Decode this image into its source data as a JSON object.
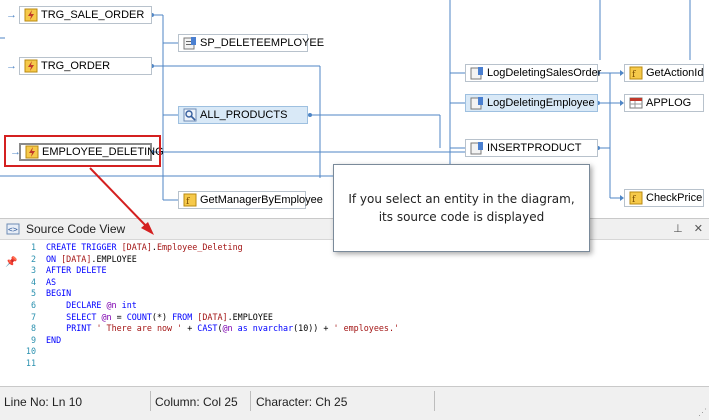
{
  "diagram": {
    "nodes": {
      "trg_sale_order": "TRG_SALE_ORDER",
      "trg_order": "TRG_ORDER",
      "employee_deleting": "EMPLOYEE_DELETING",
      "sp_deleteemployee": "SP_DELETEEMPLOYEE",
      "all_products": "ALL_PRODUCTS",
      "getmanagerbyemployee": "GetManagerByEmployee",
      "logdeletingsalesorder": "LogDeletingSalesOrder",
      "logdeletingemployee": "LogDeletingEmployee",
      "insertproduct": "INSERTPRODUCT",
      "getactionid": "GetActionId",
      "applog": "APPLOG",
      "checkprice": "CheckPrice"
    },
    "callout": "If you select an entity in the diagram, its source code is displayed",
    "colors": {
      "selection_box": "#d42020",
      "wire": "#4f86c6",
      "selected_node": "#d9e9f7"
    }
  },
  "source_panel": {
    "title": "Source Code View",
    "pin_icon": "pin-icon",
    "close_icon": "close-icon",
    "code_lines": [
      {
        "n": "1",
        "parts": [
          [
            "kw",
            "CREATE TRIGGER "
          ],
          [
            "br",
            "[DATA]"
          ],
          [
            "",
            "."
          ],
          [
            "br",
            "Employee_Deleting"
          ]
        ]
      },
      {
        "n": "2",
        "parts": [
          [
            "kw",
            "ON "
          ],
          [
            "br",
            "[DATA]"
          ],
          [
            "",
            ".EMPLOYEE"
          ]
        ]
      },
      {
        "n": "3",
        "parts": [
          [
            "kw",
            "AFTER DELETE"
          ]
        ]
      },
      {
        "n": "4",
        "parts": [
          [
            "kw",
            "AS"
          ]
        ]
      },
      {
        "n": "5",
        "parts": [
          [
            "kw",
            "BEGIN"
          ]
        ]
      },
      {
        "n": "6",
        "parts": [
          [
            "",
            "    "
          ],
          [
            "kw",
            "DECLARE "
          ],
          [
            "vr",
            "@n "
          ],
          [
            "kw",
            "int"
          ]
        ]
      },
      {
        "n": "7",
        "parts": [
          [
            "",
            "    "
          ],
          [
            "kw",
            "SELECT "
          ],
          [
            "vr",
            "@n"
          ],
          [
            "",
            " = "
          ],
          [
            "kw",
            "COUNT"
          ],
          [
            "",
            "(*) "
          ],
          [
            "kw",
            "FROM "
          ],
          [
            "br",
            "[DATA]"
          ],
          [
            "",
            ".EMPLOYEE"
          ]
        ]
      },
      {
        "n": "8",
        "parts": [
          [
            "",
            "    "
          ],
          [
            "kw",
            "PRINT "
          ],
          [
            "str",
            "' There are now '"
          ],
          [
            "",
            " + "
          ],
          [
            "kw",
            "CAST"
          ],
          [
            "",
            "("
          ],
          [
            "vr",
            "@n "
          ],
          [
            "kw",
            "as "
          ],
          [
            "kw",
            "nvarchar"
          ],
          [
            "",
            "(10)) + "
          ],
          [
            "str",
            "' employees.'"
          ]
        ]
      },
      {
        "n": "9",
        "parts": [
          [
            "kw",
            "END"
          ]
        ]
      },
      {
        "n": "10",
        "parts": []
      },
      {
        "n": "11",
        "parts": []
      }
    ]
  },
  "status_bar": {
    "line": "Line No: Ln 10",
    "column": "Column: Col 25",
    "character": "Character: Ch 25"
  }
}
